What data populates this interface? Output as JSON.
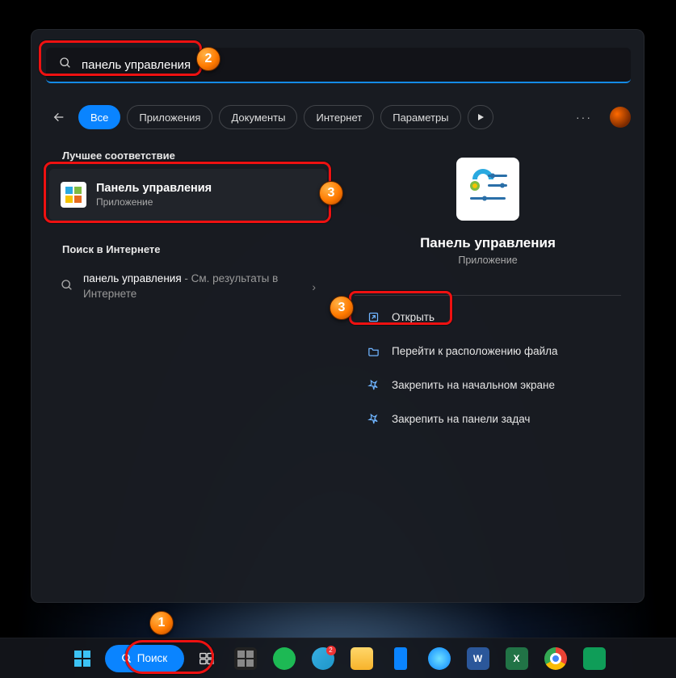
{
  "search": {
    "value": "панель управления"
  },
  "filters": {
    "all": "Все",
    "apps": "Приложения",
    "docs": "Документы",
    "web": "Интернет",
    "settings": "Параметры"
  },
  "sections": {
    "best_match": "Лучшее соответствие",
    "web_search": "Поиск в Интернете"
  },
  "best_match": {
    "title": "Панель управления",
    "subtitle": "Приложение"
  },
  "web_result": {
    "query": "панель управления",
    "suffix": " - См. результаты в Интернете"
  },
  "detail": {
    "title": "Панель управления",
    "subtitle": "Приложение",
    "actions": {
      "open": "Открыть",
      "open_location": "Перейти к расположению файла",
      "pin_start": "Закрепить на начальном экране",
      "pin_taskbar": "Закрепить на панели задач"
    }
  },
  "taskbar": {
    "search_label": "Поиск"
  },
  "annotations": {
    "b1": "1",
    "b2": "2",
    "b3": "3"
  }
}
